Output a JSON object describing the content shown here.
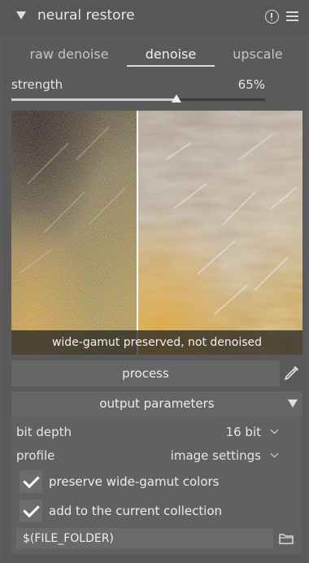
{
  "module": {
    "title": "neural restore",
    "collapse_icon": "triangle-down-icon",
    "info_icon": "info-circle-icon",
    "menu_icon": "hamburger-menu-icon"
  },
  "tabs": [
    {
      "label": "raw denoise",
      "active": false
    },
    {
      "label": "denoise",
      "active": true
    },
    {
      "label": "upscale",
      "active": false
    }
  ],
  "strength": {
    "label": "strength",
    "value_text": "65%",
    "value": 0.65
  },
  "preview": {
    "caption": "wide-gamut preserved, not denoised",
    "split_position": 0.43
  },
  "process": {
    "label": "process",
    "picker_icon": "color-picker-icon"
  },
  "output": {
    "header": "output parameters",
    "collapse_icon": "triangle-down-icon",
    "bit_depth": {
      "label": "bit depth",
      "value": "16 bit"
    },
    "profile": {
      "label": "profile",
      "value": "image settings"
    },
    "preserve_gamut": {
      "label": "preserve wide-gamut colors",
      "checked": true
    },
    "add_collection": {
      "label": "add to the current collection",
      "checked": true
    },
    "path": "$(FILE_FOLDER)",
    "folder_icon": "folder-icon"
  },
  "colors": {
    "panel": "#5c5c5c",
    "button": "#666666",
    "slider_fill": "#cfcfcf",
    "text": "#e4e4e4"
  }
}
